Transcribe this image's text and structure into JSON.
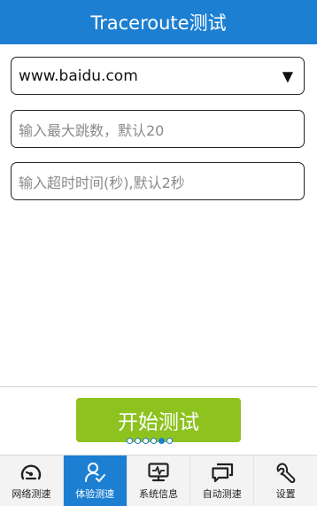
{
  "header": {
    "title": "Traceroute测试"
  },
  "form": {
    "host_select": {
      "value": "www.baidu.com"
    },
    "max_hops": {
      "placeholder": "输入最大跳数，默认20"
    },
    "timeout": {
      "placeholder": "输入超时时间(秒),默认2秒"
    }
  },
  "start_button": {
    "label": "开始测试"
  },
  "pager": {
    "count": 6,
    "active_index": 4
  },
  "tabs": [
    {
      "label": "网络测速",
      "icon": "speedometer-icon",
      "active": false
    },
    {
      "label": "体验测速",
      "icon": "user-check-icon",
      "active": true
    },
    {
      "label": "系统信息",
      "icon": "monitor-icon",
      "active": false
    },
    {
      "label": "自动测速",
      "icon": "chat-bubbles-icon",
      "active": false
    },
    {
      "label": "设置",
      "icon": "wrench-icon",
      "active": false
    }
  ],
  "colors": {
    "primary": "#1c7fd2",
    "accent_button": "#8dc21f",
    "tab_bg": "#f3f3f3"
  }
}
